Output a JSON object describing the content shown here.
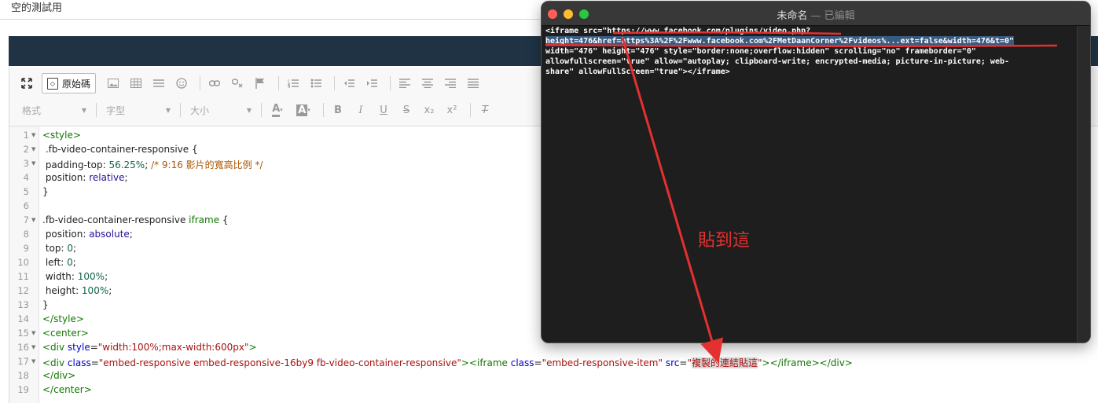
{
  "page_title_field": {
    "value": "空的測試用"
  },
  "toolbar": {
    "source_label": "原始碼",
    "format_combo": "格式",
    "font_combo": "字型",
    "size_combo": "大小",
    "icons_row1": [
      "maximize-icon",
      "image-icon",
      "table-icon",
      "horizontal-rule-icon",
      "smiley-icon",
      "link-icon",
      "unlink-icon",
      "anchor-flag-icon",
      "numbered-list-icon",
      "bulleted-list-icon",
      "outdent-icon",
      "indent-icon",
      "align-left-icon",
      "align-center-icon",
      "align-right-icon",
      "justify-icon"
    ],
    "style_buttons": {
      "bold": "B",
      "italic": "I",
      "underline": "U",
      "strike": "S",
      "subscript": "x₂",
      "superscript": "x²",
      "clear_format": "T̶"
    }
  },
  "code_lines": [
    {
      "n": "1"
    },
    {
      "n": "2"
    },
    {
      "n": "3"
    },
    {
      "n": "4"
    },
    {
      "n": "5"
    },
    {
      "n": "6"
    },
    {
      "n": "7"
    },
    {
      "n": "8"
    },
    {
      "n": "9"
    },
    {
      "n": "10"
    },
    {
      "n": "11"
    },
    {
      "n": "12"
    },
    {
      "n": "13"
    },
    {
      "n": "14"
    },
    {
      "n": "15"
    },
    {
      "n": "16"
    },
    {
      "n": "17"
    },
    {
      "n": "18"
    },
    {
      "n": "19"
    }
  ],
  "code": {
    "l1": "<style>",
    "l2": " .fb-video-container-responsive {",
    "l3a": " padding-top: ",
    "l3b": "56.25%",
    "l3c": "; ",
    "l3d": "/* 9:16 影片的寬高比例 */",
    "l4a": " position: ",
    "l4b": "relative",
    "l4c": ";",
    "l5": "}",
    "l7a": ".fb-video-container-responsive ",
    "l7b": "iframe",
    "l7c": " {",
    "l8a": " position: ",
    "l8b": "absolute",
    "l8c": ";",
    "l9a": " top: ",
    "l9b": "0",
    "l9c": ";",
    "l10a": " left: ",
    "l10b": "0",
    "l10c": ";",
    "l11a": " width: ",
    "l11b": "100%",
    "l11c": ";",
    "l12a": " height: ",
    "l12b": "100%",
    "l12c": ";",
    "l13": "}",
    "l14": "</style>",
    "l15": "<center>",
    "l16a": "<div ",
    "l16b": "style",
    "l16c": "=",
    "l16d": "\"width:100%;max-width:600px\"",
    "l16e": ">",
    "l17a": "<div ",
    "l17b": "class",
    "l17c": "=",
    "l17d": "\"embed-responsive embed-responsive-16by9 fb-video-container-responsive\"",
    "l17e": "><iframe ",
    "l17f": "class",
    "l17g": "=",
    "l17h": "\"embed-responsive-item\"",
    "l17i": " src",
    "l17j": "=",
    "l17k": "\"",
    "l17l": "複製的連結貼這",
    "l17m": "\"",
    "l17n": "></iframe></div>",
    "l18": "</div>",
    "l19": "</center>"
  },
  "editor_window": {
    "title": "未命名",
    "subtitle": " — 已編輯",
    "lines": [
      "<iframe src=\"https://www.facebook.com/plugins/video.php?",
      "height=476&href=https%3A%2F%2Fwww.facebook.com%2FMetDaanCorner%2Fvideos%...ext=false&width=476&t=0\"",
      "width=\"476\" height=\"476\" style=\"border:none;overflow:hidden\" scrolling=\"no\" frameborder=\"0\"",
      "allowfullscreen=\"true\" allow=\"autoplay; clipboard-write; encrypted-media; picture-in-picture; web-",
      "share\" allowFullScreen=\"true\"></iframe>"
    ]
  },
  "annotation": {
    "text": "貼到這",
    "color": "#e53030"
  }
}
